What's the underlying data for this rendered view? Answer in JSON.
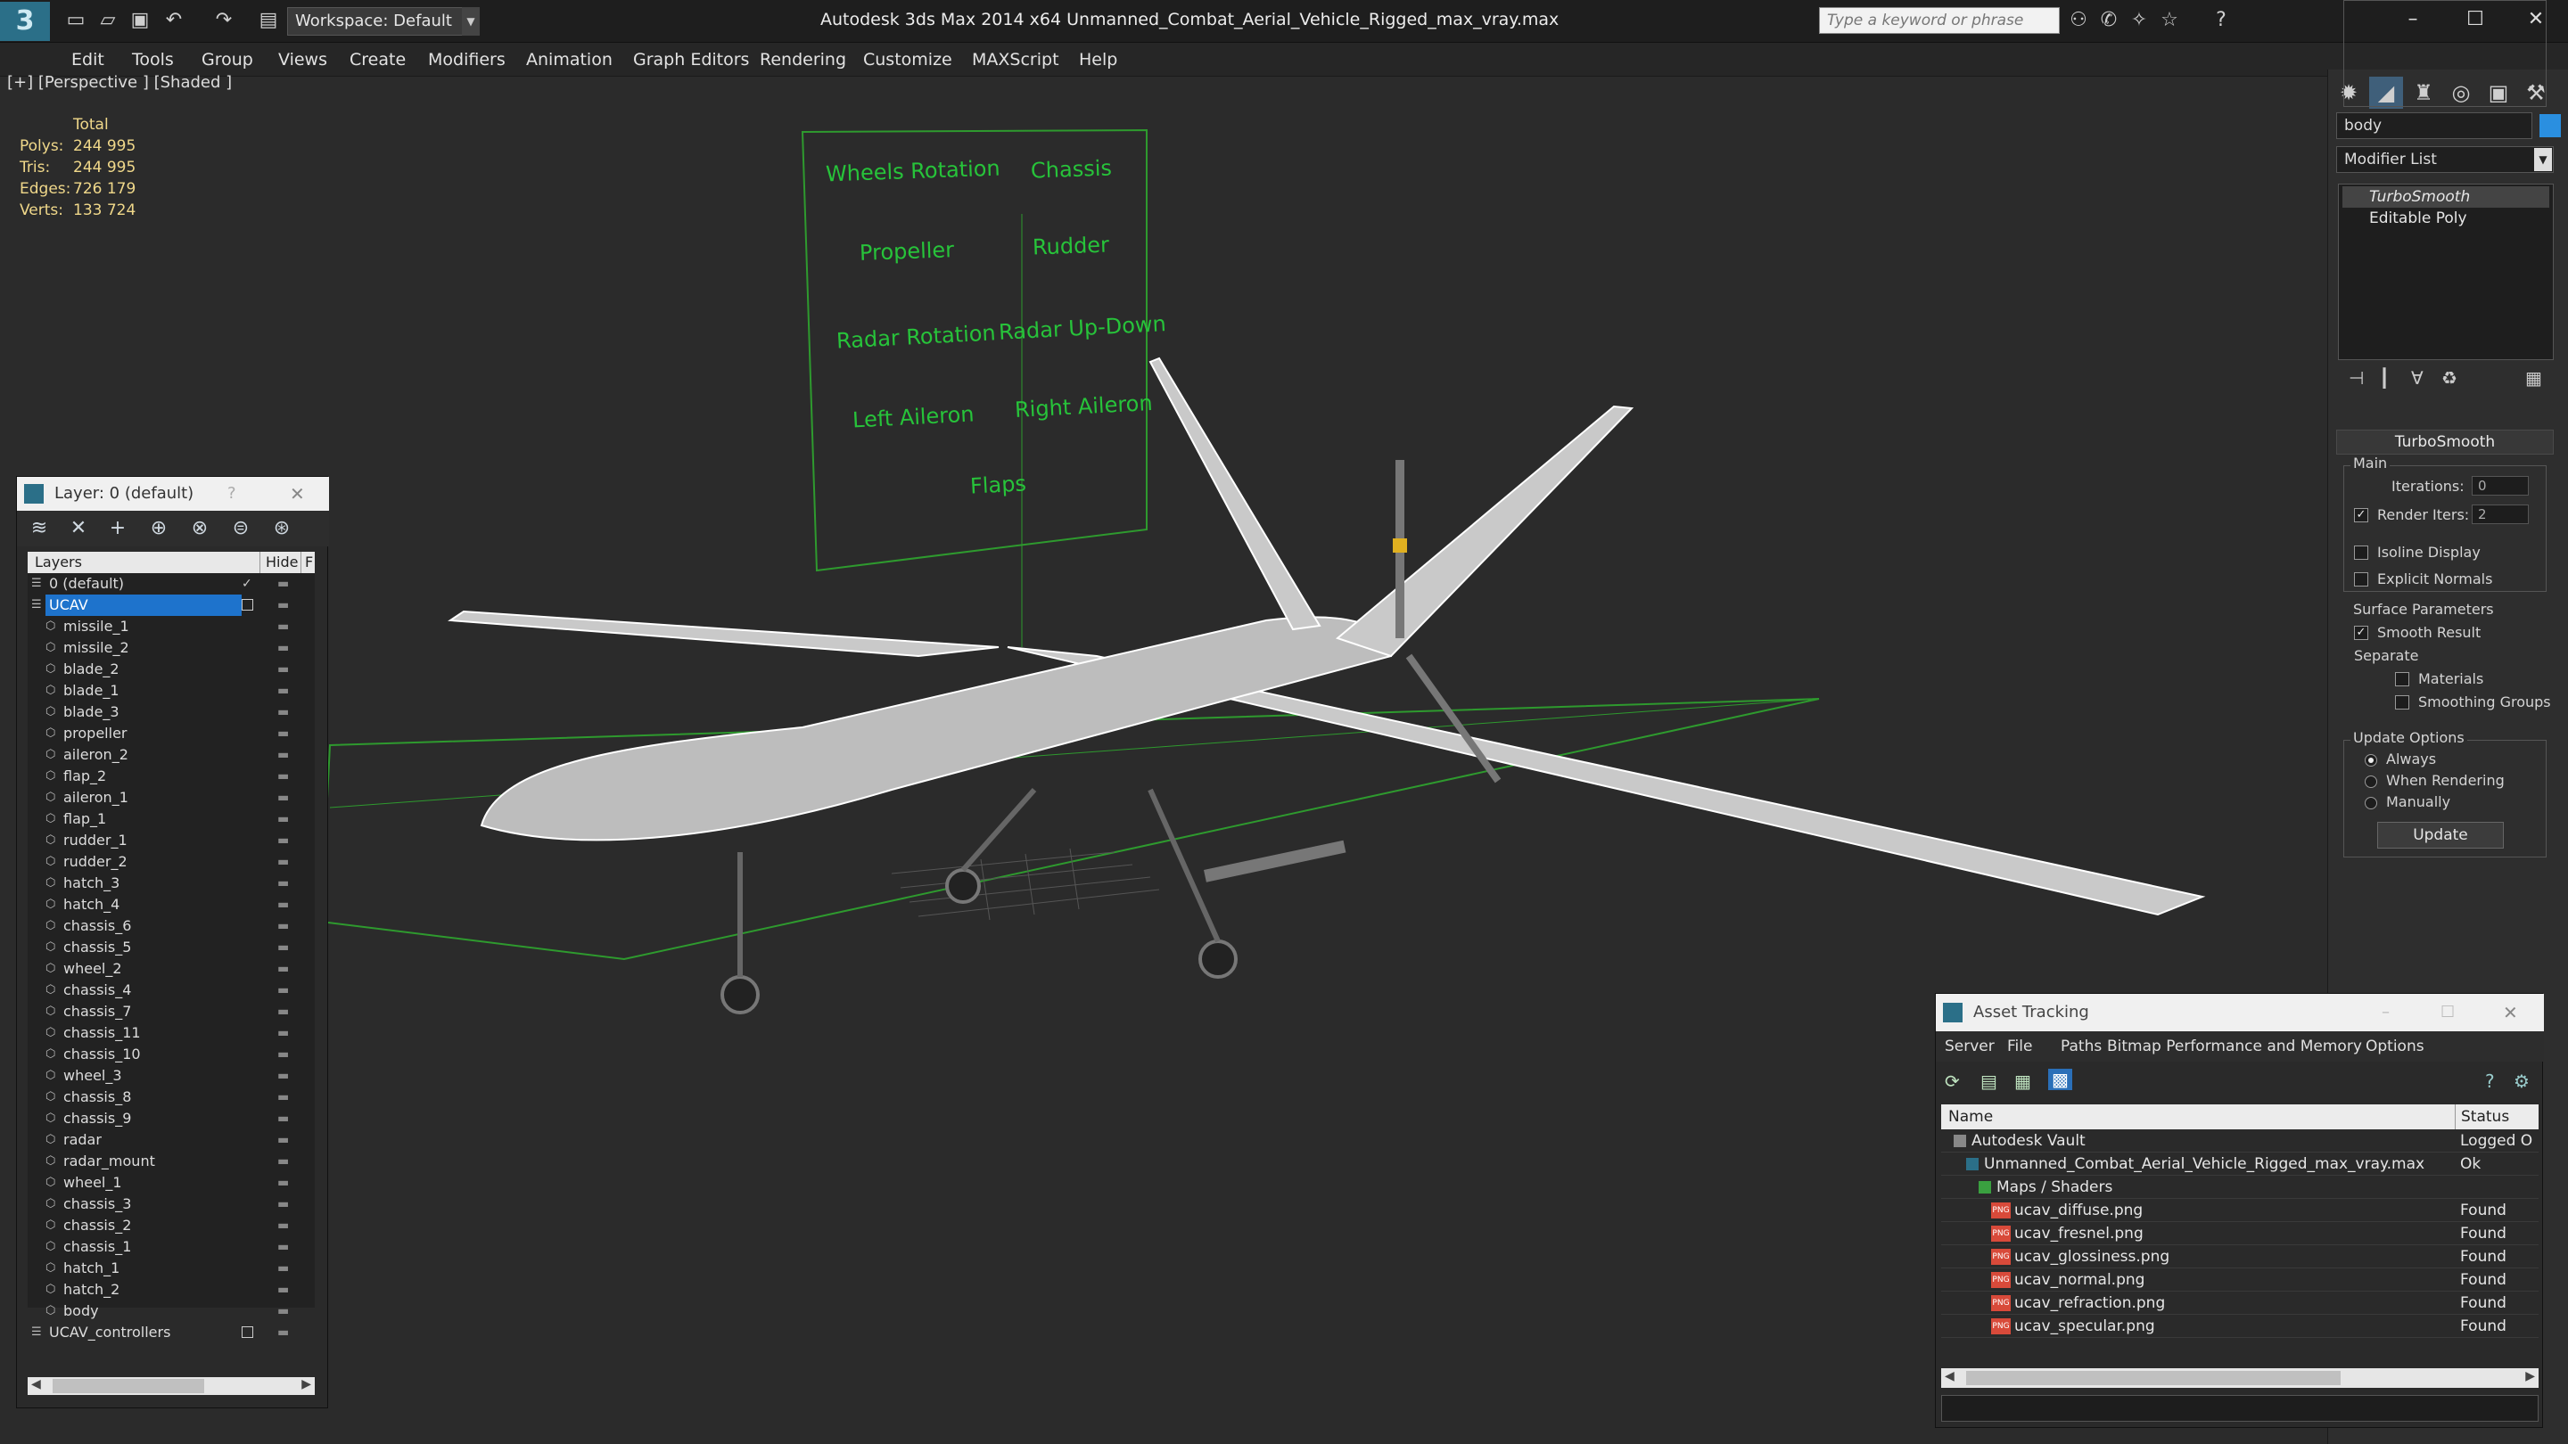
{
  "app": {
    "logo_glyph": "3",
    "title": "Autodesk 3ds Max  2014 x64     Unmanned_Combat_Aerial_Vehicle_Rigged_max_vray.max",
    "workspace": "Workspace: Default",
    "search_placeholder": "Type a keyword or phrase"
  },
  "menu": [
    "Edit",
    "Tools",
    "Group",
    "Views",
    "Create",
    "Modifiers",
    "Animation",
    "Graph Editors",
    "Rendering",
    "Customize",
    "MAXScript",
    "Help"
  ],
  "viewport": {
    "label": "[+] [Perspective ] [Shaded ]",
    "stats": {
      "header": "Total",
      "rows": [
        {
          "label": "Polys:",
          "value": "244 995"
        },
        {
          "label": "Tris:",
          "value": "244 995"
        },
        {
          "label": "Edges:",
          "value": "726 179"
        },
        {
          "label": "Verts:",
          "value": "133 724"
        }
      ]
    },
    "control_panel_labels": [
      "Wheels Rotation",
      "Chassis",
      "Propeller",
      "Rudder",
      "Radar Rotation",
      "Radar Up-Down",
      "Left Aileron",
      "Right Aileron",
      "Flaps"
    ],
    "accent_color": "#27c33a"
  },
  "command_panel": {
    "object_name": "body",
    "modifier_list": "Modifier List",
    "stack": [
      "TurboSmooth",
      "Editable Poly"
    ],
    "rollout_title": "TurboSmooth",
    "main_group": "Main",
    "iterations_label": "Iterations:",
    "iterations_value": "0",
    "render_iters_label": "Render Iters:",
    "render_iters_value": "2",
    "isoline_display": "Isoline Display",
    "explicit_normals": "Explicit Normals",
    "surface_params": "Surface Parameters",
    "smooth_result": "Smooth Result",
    "separate": "Separate",
    "materials": "Materials",
    "smoothing_groups": "Smoothing Groups",
    "update_options": "Update Options",
    "always": "Always",
    "when_rendering": "When Rendering",
    "manually": "Manually",
    "update_button": "Update"
  },
  "layer_window": {
    "title": "Layer: 0 (default)",
    "help": "?",
    "col_layers": "Layers",
    "col_hide": "Hide",
    "col_f": "F",
    "layers": [
      {
        "name": "0 (default)",
        "level": 0,
        "checked": true
      },
      {
        "name": "UCAV",
        "level": 0,
        "selected": true
      },
      {
        "name": "missile_1",
        "level": 1
      },
      {
        "name": "missile_2",
        "level": 1
      },
      {
        "name": "blade_2",
        "level": 1
      },
      {
        "name": "blade_1",
        "level": 1
      },
      {
        "name": "blade_3",
        "level": 1
      },
      {
        "name": "propeller",
        "level": 1
      },
      {
        "name": "aileron_2",
        "level": 1
      },
      {
        "name": "flap_2",
        "level": 1
      },
      {
        "name": "aileron_1",
        "level": 1
      },
      {
        "name": "flap_1",
        "level": 1
      },
      {
        "name": "rudder_1",
        "level": 1
      },
      {
        "name": "rudder_2",
        "level": 1
      },
      {
        "name": "hatch_3",
        "level": 1
      },
      {
        "name": "hatch_4",
        "level": 1
      },
      {
        "name": "chassis_6",
        "level": 1
      },
      {
        "name": "chassis_5",
        "level": 1
      },
      {
        "name": "wheel_2",
        "level": 1
      },
      {
        "name": "chassis_4",
        "level": 1
      },
      {
        "name": "chassis_7",
        "level": 1
      },
      {
        "name": "chassis_11",
        "level": 1
      },
      {
        "name": "chassis_10",
        "level": 1
      },
      {
        "name": "wheel_3",
        "level": 1
      },
      {
        "name": "chassis_8",
        "level": 1
      },
      {
        "name": "chassis_9",
        "level": 1
      },
      {
        "name": "radar",
        "level": 1
      },
      {
        "name": "radar_mount",
        "level": 1
      },
      {
        "name": "wheel_1",
        "level": 1
      },
      {
        "name": "chassis_3",
        "level": 1
      },
      {
        "name": "chassis_2",
        "level": 1
      },
      {
        "name": "chassis_1",
        "level": 1
      },
      {
        "name": "hatch_1",
        "level": 1
      },
      {
        "name": "hatch_2",
        "level": 1
      },
      {
        "name": "body",
        "level": 1
      },
      {
        "name": "UCAV_controllers",
        "level": 0
      }
    ]
  },
  "asset_window": {
    "title": "Asset Tracking",
    "menu": [
      "Server",
      "File",
      "Paths",
      "Bitmap Performance and Memory",
      "Options"
    ],
    "col_name": "Name",
    "col_status": "Status",
    "rows": [
      {
        "name": "Autodesk Vault",
        "status": "Logged O",
        "indent": 1
      },
      {
        "name": "Unmanned_Combat_Aerial_Vehicle_Rigged_max_vray.max",
        "status": "Ok",
        "indent": 2
      },
      {
        "name": "Maps / Shaders",
        "status": "",
        "indent": 3
      },
      {
        "name": "ucav_diffuse.png",
        "status": "Found",
        "indent": 4
      },
      {
        "name": "ucav_fresnel.png",
        "status": "Found",
        "indent": 4
      },
      {
        "name": "ucav_glossiness.png",
        "status": "Found",
        "indent": 4
      },
      {
        "name": "ucav_normal.png",
        "status": "Found",
        "indent": 4
      },
      {
        "name": "ucav_refraction.png",
        "status": "Found",
        "indent": 4
      },
      {
        "name": "ucav_specular.png",
        "status": "Found",
        "indent": 4
      }
    ]
  }
}
